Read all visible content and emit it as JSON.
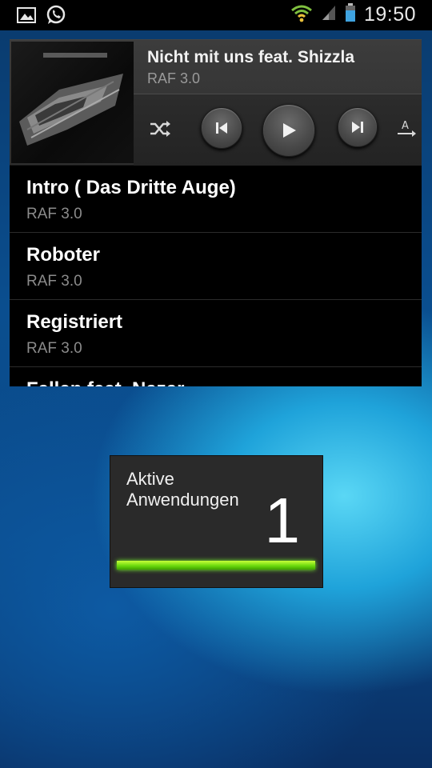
{
  "status_bar": {
    "time": "19:50",
    "icons": [
      "gallery-notification-icon",
      "whatsapp-icon",
      "wifi-icon",
      "signal-icon",
      "battery-icon"
    ]
  },
  "music_widget": {
    "now_playing": {
      "title": "Nicht mit uns feat. Shizzla",
      "artist": "RAF 3.0"
    },
    "controls": [
      "shuffle-icon",
      "previous-icon",
      "play-icon",
      "next-icon",
      "repeat-icon"
    ],
    "playlist": [
      {
        "title": "Intro ( Das Dritte Auge)",
        "artist": "RAF 3.0"
      },
      {
        "title": "Roboter",
        "artist": "RAF 3.0"
      },
      {
        "title": "Registriert",
        "artist": "RAF 3.0"
      },
      {
        "title": "Fallen feat. Nazar",
        "artist": ""
      }
    ]
  },
  "task_manager": {
    "label": "Aktive Anwendungen",
    "count": "1",
    "bar_fill_fraction": 1.0,
    "bar_color": "#6cdb0e"
  }
}
